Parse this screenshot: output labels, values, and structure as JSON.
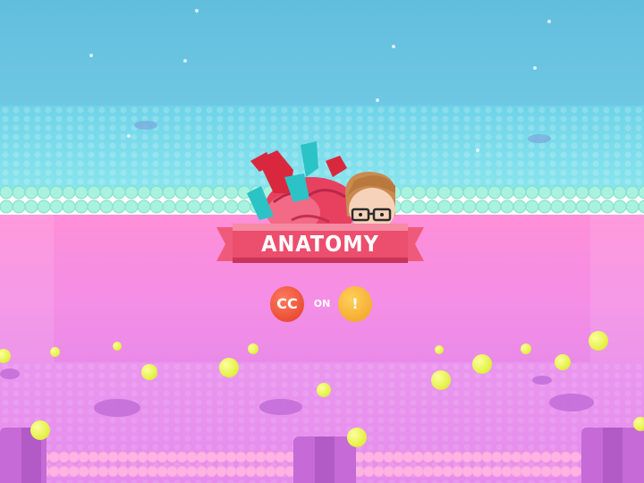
{
  "title": "ANATOMY",
  "badges": {
    "left_text": "CC",
    "left_icon": "crash-course-apple-icon",
    "connector": "ON",
    "right_text": "!",
    "right_icon": "youtube-kids-icon"
  },
  "colors": {
    "sky": "#66c2e0",
    "membrane_cyan": "#7bdcea",
    "pink": "#ff8fd8",
    "ribbon": "#ec4e6e",
    "cc_badge": "#e84c30",
    "yt_badge": "#f5b02c",
    "ball": "#e9f44c"
  }
}
